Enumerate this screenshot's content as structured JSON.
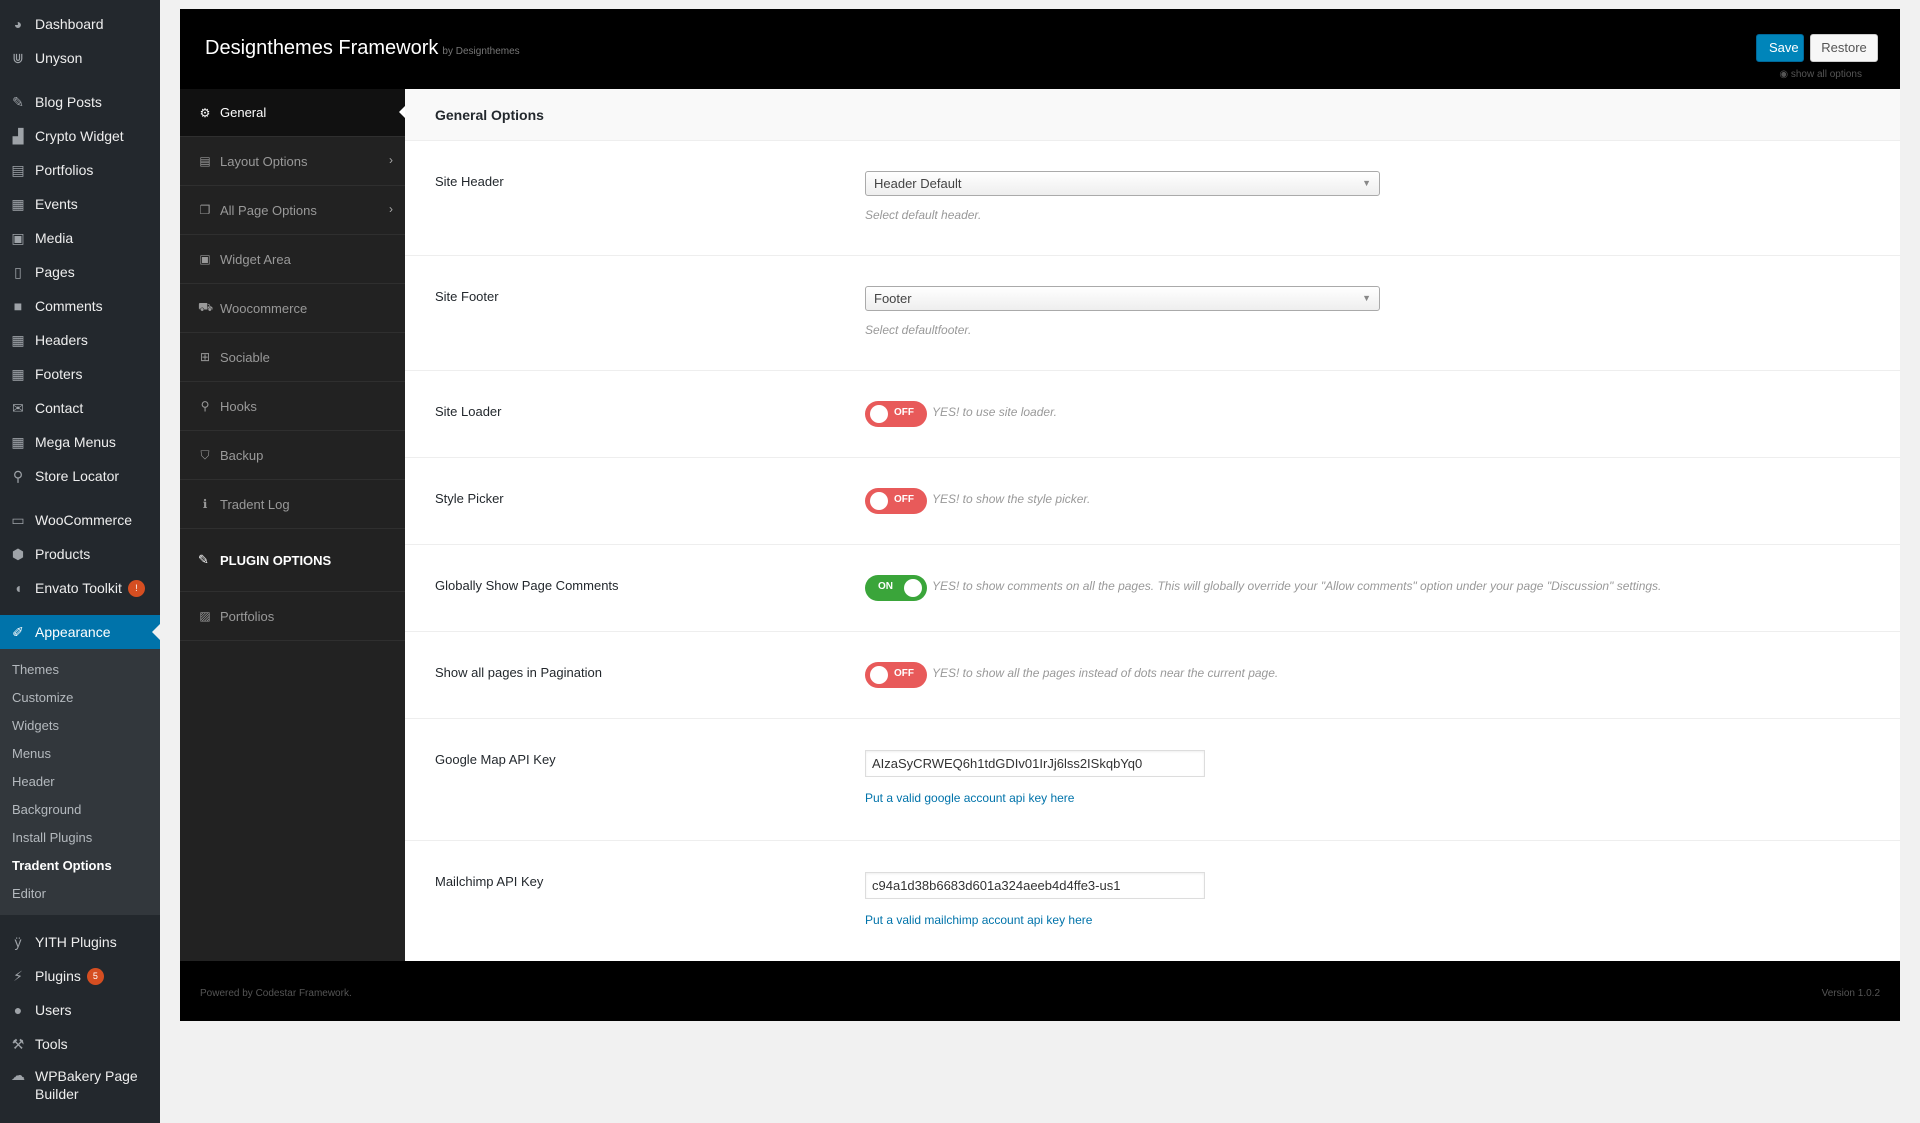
{
  "wp_menu": {
    "items": [
      {
        "label": "Dashboard",
        "icon": "dashboard-icon",
        "glyph": "◕"
      },
      {
        "label": "Unyson",
        "icon": "unyson-icon",
        "glyph": "⋓"
      },
      {
        "label": "Blog Posts",
        "icon": "pin-icon",
        "glyph": "✎"
      },
      {
        "label": "Crypto Widget",
        "icon": "chart-icon",
        "glyph": "▟"
      },
      {
        "label": "Portfolios",
        "icon": "portfolio-icon",
        "glyph": "▤"
      },
      {
        "label": "Events",
        "icon": "calendar-icon",
        "glyph": "▦"
      },
      {
        "label": "Media",
        "icon": "media-icon",
        "glyph": "▣"
      },
      {
        "label": "Pages",
        "icon": "pages-icon",
        "glyph": "▯"
      },
      {
        "label": "Comments",
        "icon": "comment-icon",
        "glyph": "■"
      },
      {
        "label": "Headers",
        "icon": "grid-icon",
        "glyph": "▦"
      },
      {
        "label": "Footers",
        "icon": "grid-icon",
        "glyph": "▦"
      },
      {
        "label": "Contact",
        "icon": "mail-icon",
        "glyph": "✉"
      },
      {
        "label": "Mega Menus",
        "icon": "grid-icon",
        "glyph": "▦"
      },
      {
        "label": "Store Locator",
        "icon": "location-pin-icon",
        "glyph": "⚲"
      },
      {
        "label": "WooCommerce",
        "icon": "woocommerce-icon",
        "glyph": "▭"
      },
      {
        "label": "Products",
        "icon": "box-icon",
        "glyph": "⬢"
      },
      {
        "label": "Envato Toolkit",
        "icon": "leaf-icon",
        "glyph": "◖",
        "badge": "!"
      },
      {
        "label": "Appearance",
        "icon": "brush-icon",
        "glyph": "✐"
      },
      {
        "label": "YITH Plugins",
        "icon": "yith-icon",
        "glyph": "ÿ"
      },
      {
        "label": "Plugins",
        "icon": "plug-icon",
        "glyph": "⚡",
        "badge": "5"
      },
      {
        "label": "Users",
        "icon": "user-icon",
        "glyph": "●"
      },
      {
        "label": "Tools",
        "icon": "wrench-icon",
        "glyph": "⚒"
      },
      {
        "label": "WPBakery Page Builder",
        "icon": "cloud-icon",
        "glyph": "☁"
      }
    ],
    "submenu": [
      "Themes",
      "Customize",
      "Widgets",
      "Menus",
      "Header",
      "Background",
      "Install Plugins",
      "Tradent Options",
      "Editor"
    ]
  },
  "header": {
    "title": "Designthemes Framework",
    "by": "by Designthemes",
    "save_label": "Save",
    "restore_label": "Restore",
    "show_all": "show all options"
  },
  "nav": {
    "items": [
      {
        "label": "General",
        "icon": "gears-icon",
        "glyph": "⚙"
      },
      {
        "label": "Layout Options",
        "icon": "layout-icon",
        "glyph": "▤"
      },
      {
        "label": "All Page Options",
        "icon": "copy-icon",
        "glyph": "❐"
      },
      {
        "label": "Widget Area",
        "icon": "widget-icon",
        "glyph": "▣"
      },
      {
        "label": "Woocommerce",
        "icon": "cart-icon",
        "glyph": "⛟"
      },
      {
        "label": "Sociable",
        "icon": "share-icon",
        "glyph": "⊞"
      },
      {
        "label": "Hooks",
        "icon": "paperclip-icon",
        "glyph": "⚲"
      },
      {
        "label": "Backup",
        "icon": "shield-icon",
        "glyph": "⛉"
      },
      {
        "label": "Tradent Log",
        "icon": "info-icon",
        "glyph": "ℹ"
      }
    ],
    "plugin_heading": "PLUGIN OPTIONS",
    "plugin_items": [
      {
        "label": "Portfolios",
        "icon": "image-icon",
        "glyph": "▨"
      }
    ]
  },
  "content": {
    "section_title": "General Options",
    "site_header": {
      "label": "Site Header",
      "value": "Header Default",
      "desc": "Select default header."
    },
    "site_footer": {
      "label": "Site Footer",
      "value": "Footer",
      "desc": "Select defaultfooter."
    },
    "site_loader": {
      "label": "Site Loader",
      "state": "OFF",
      "desc": "YES! to use site loader."
    },
    "style_picker": {
      "label": "Style Picker",
      "state": "OFF",
      "desc": "YES! to show the style picker."
    },
    "global_comments": {
      "label": "Globally Show Page Comments",
      "state": "ON",
      "desc": "YES! to show comments on all the pages. This will globally override your \"Allow comments\" option under your page \"Discussion\" settings."
    },
    "pagination": {
      "label": "Show all pages in Pagination",
      "state": "OFF",
      "desc": "YES! to show all the pages instead of dots near the current page."
    },
    "google_map": {
      "label": "Google Map API Key",
      "value": "AIzaSyCRWEQ6h1tdGDIv01IrJj6lss2ISkqbYq0",
      "link": "Put a valid google account api key here"
    },
    "mailchimp": {
      "label": "Mailchimp API Key",
      "value": "c94a1d38b6683d601a324aeeb4d4ffe3-us1",
      "link": "Put a valid mailchimp account api key here"
    }
  },
  "footer": {
    "powered": "Powered by Codestar Framework.",
    "version": "Version 1.0.2"
  },
  "colors": {
    "accent": "#0073aa",
    "toggle_off": "#e85a5a",
    "toggle_on": "#3aa53a"
  }
}
